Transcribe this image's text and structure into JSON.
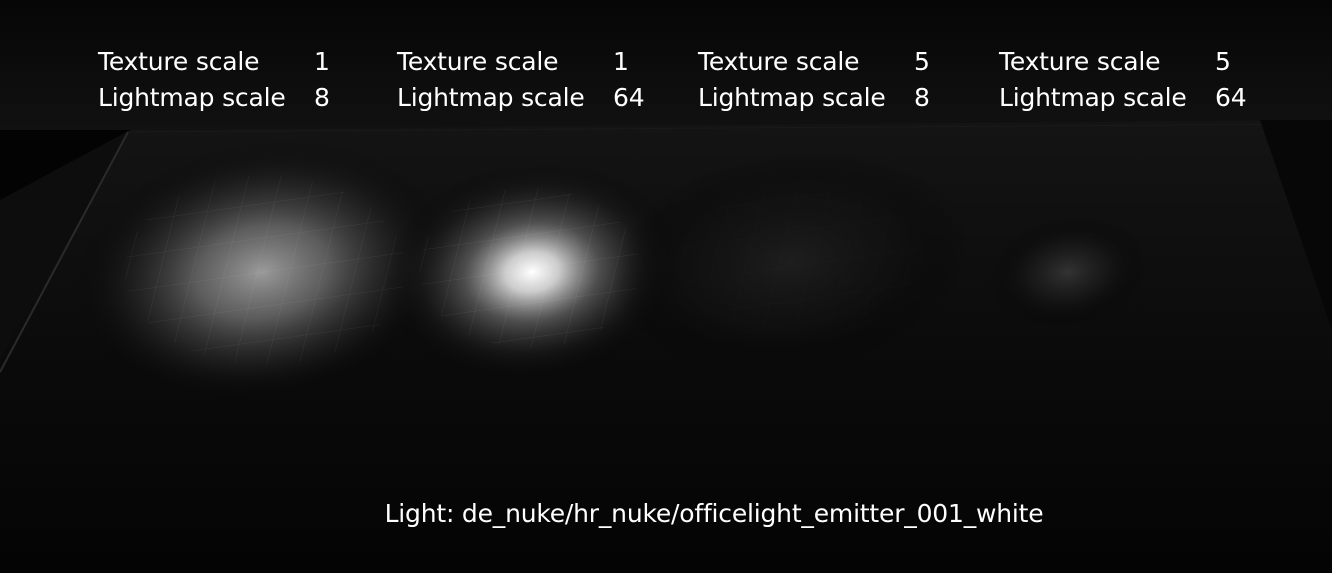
{
  "panels": [
    {
      "texture_label": "Texture scale",
      "texture_value": "1",
      "lightmap_label": "Lightmap scale",
      "lightmap_value": "8"
    },
    {
      "texture_label": "Texture scale",
      "texture_value": "1",
      "lightmap_label": "Lightmap scale",
      "lightmap_value": "64"
    },
    {
      "texture_label": "Texture scale",
      "texture_value": "5",
      "lightmap_label": "Lightmap scale",
      "lightmap_value": "8"
    },
    {
      "texture_label": "Texture scale",
      "texture_value": "5",
      "lightmap_label": "Lightmap scale",
      "lightmap_value": "64"
    }
  ],
  "caption": "Light: de_nuke/hr_nuke/officelight_emitter_001_white",
  "colors": {
    "background": "#030303",
    "text": "#ffffff",
    "light": "#ffffff"
  }
}
